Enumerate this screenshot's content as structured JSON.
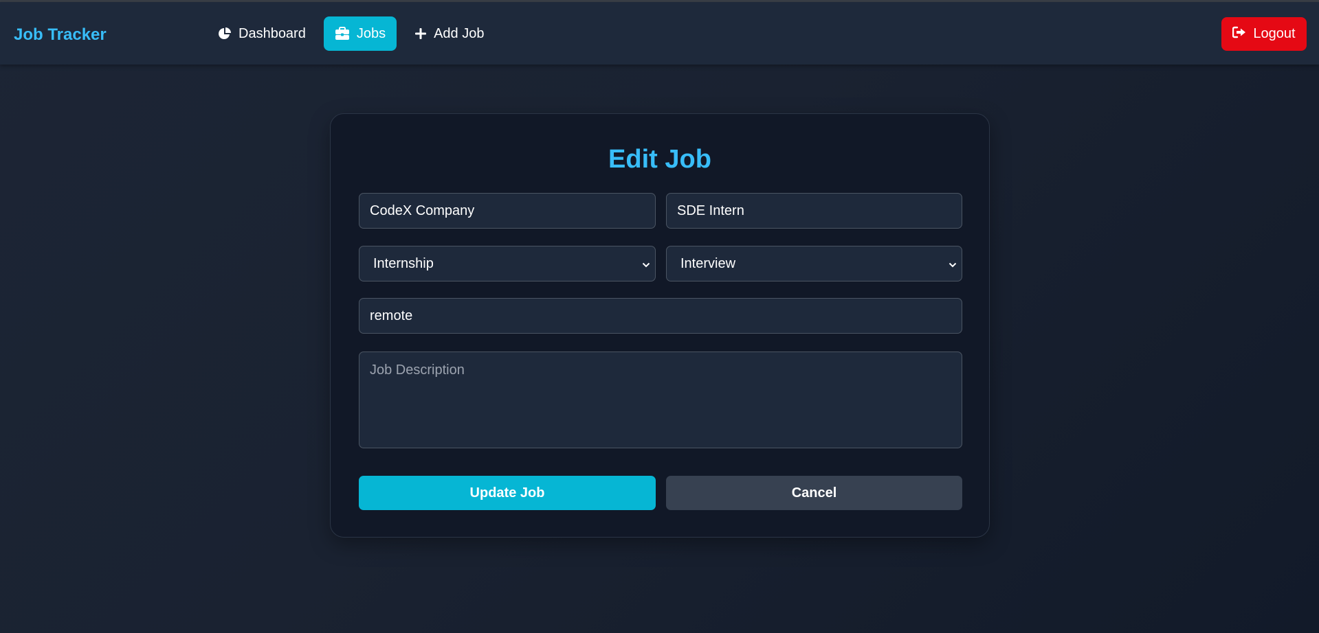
{
  "app": {
    "brand": "Job Tracker"
  },
  "nav": {
    "items": [
      {
        "label": "Dashboard",
        "icon": "pie-chart-icon",
        "active": false
      },
      {
        "label": "Jobs",
        "icon": "briefcase-icon",
        "active": true
      },
      {
        "label": "Add Job",
        "icon": "plus-icon",
        "active": false
      }
    ],
    "logout_label": "Logout",
    "logout_icon": "sign-out-icon"
  },
  "form": {
    "title": "Edit Job",
    "company": {
      "value": "CodeX Company"
    },
    "position": {
      "value": "SDE Intern"
    },
    "job_type": {
      "selected": "Internship"
    },
    "status": {
      "selected": "Interview"
    },
    "location": {
      "value": "remote"
    },
    "description": {
      "value": "",
      "placeholder": "Job Description"
    },
    "update_label": "Update Job",
    "cancel_label": "Cancel"
  },
  "colors": {
    "accent": "#38bdf8",
    "primary_button": "#06b6d4",
    "logout_button": "#e50914",
    "navbar": "#1e293b",
    "card": "#111827"
  }
}
